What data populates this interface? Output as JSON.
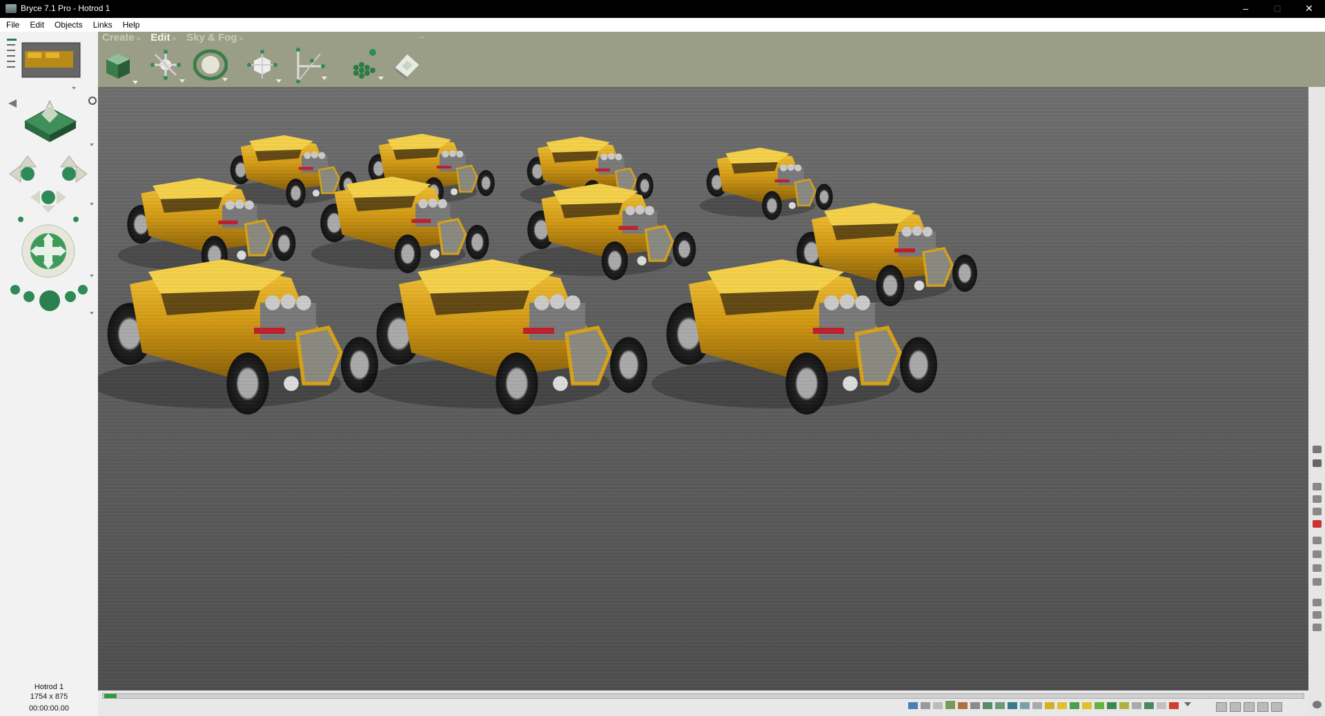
{
  "window": {
    "title": "Bryce 7.1  Pro - Hotrod 1",
    "minimize": "–",
    "maximize": "□",
    "close": "✕"
  },
  "menu": [
    "File",
    "Edit",
    "Objects",
    "Links",
    "Help"
  ],
  "palette_tabs": {
    "create": "Create",
    "edit": "Edit",
    "sky_fog": "Sky & Fog"
  },
  "tools": [
    "resize-tool-icon",
    "rotate-tool-icon",
    "reposition-tool-icon",
    "edit-geometry-tool-icon",
    "twirl-tool-icon",
    "object-sets-icon",
    "terrain-editor-icon"
  ],
  "document": {
    "name": "Hotrod 1",
    "dimensions": "1754 x 875",
    "time": "00:00:00.00"
  },
  "colors": {
    "toolbar": "#9a9e86",
    "car_paint": "#d9a516",
    "accent_green": "#2e8b57"
  }
}
